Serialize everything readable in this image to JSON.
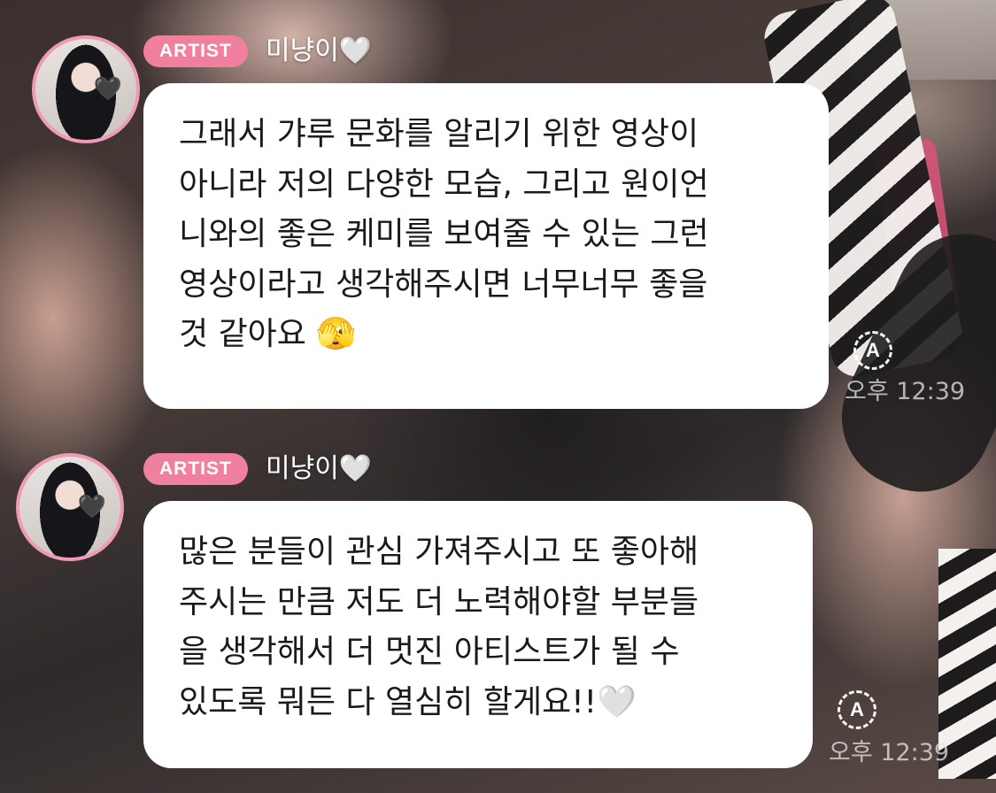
{
  "messages": [
    {
      "badge": "ARTIST",
      "username": "미냥이🤍",
      "avatar_heart": "🖤",
      "lines": [
        "그래서 갸루 문화를 알리기 위한 영상이",
        "아니라 저의 다양한 모습, 그리고 원이언",
        "니와의 좋은 케미를 보여줄 수 있는 그런",
        "영상이라고 생각해주시면 너무너무 좋을",
        "것 같아요 🫣"
      ],
      "read_icon": "A",
      "time": "오후 12:39"
    },
    {
      "badge": "ARTIST",
      "username": "미냥이🤍",
      "avatar_heart": "🖤",
      "lines": [
        "많은 분들이 관심 가져주시고 또 좋아해",
        "주시는 만큼 저도 더 노력해야할 부분들",
        "을 생각해서 더 멋진 아티스트가 될 수",
        "있도록 뭐든 다 열심히 할게요!!🤍"
      ],
      "read_icon": "A",
      "time": "오후 12:39"
    }
  ]
}
